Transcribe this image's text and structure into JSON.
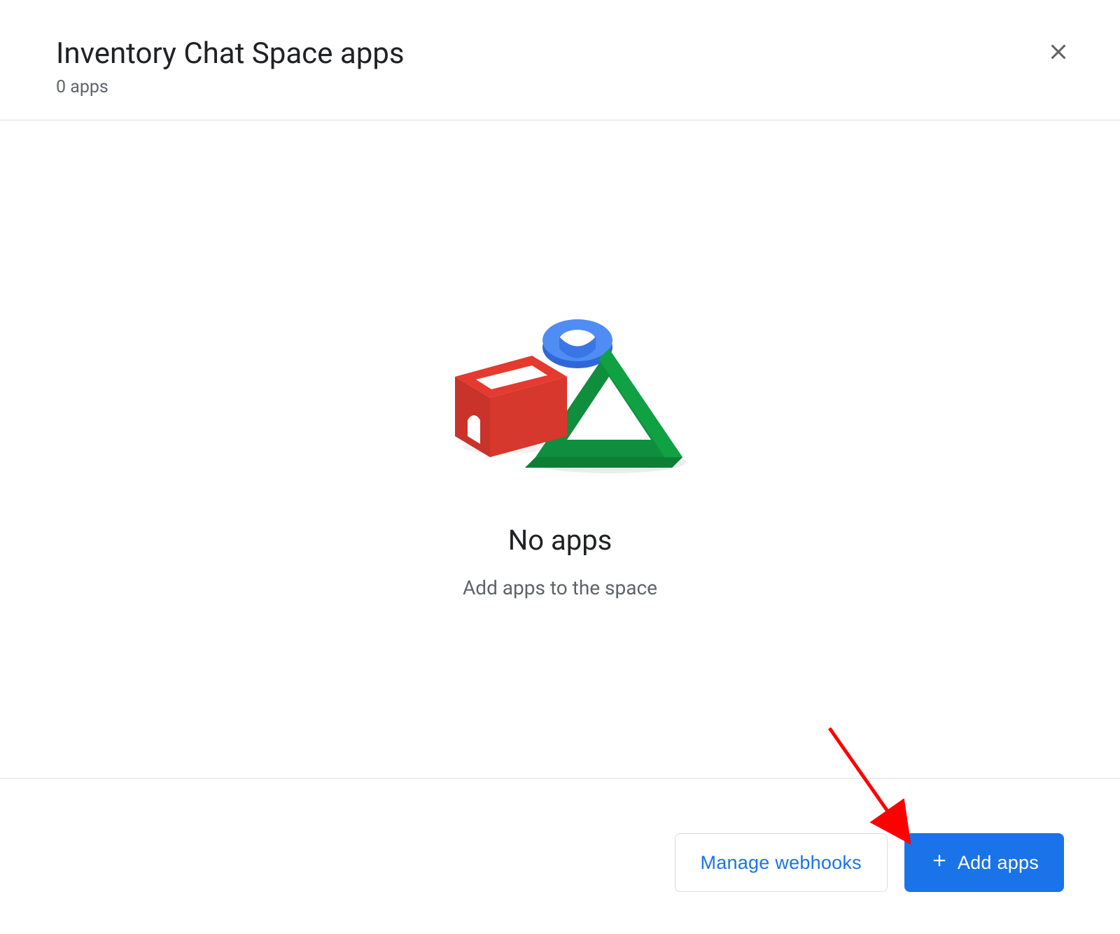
{
  "header": {
    "title": "Inventory Chat Space apps",
    "subtitle": "0 apps"
  },
  "empty": {
    "title": "No apps",
    "subtitle": "Add apps to the space"
  },
  "footer": {
    "manage_webhooks_label": "Manage webhooks",
    "add_apps_label": "Add apps"
  }
}
